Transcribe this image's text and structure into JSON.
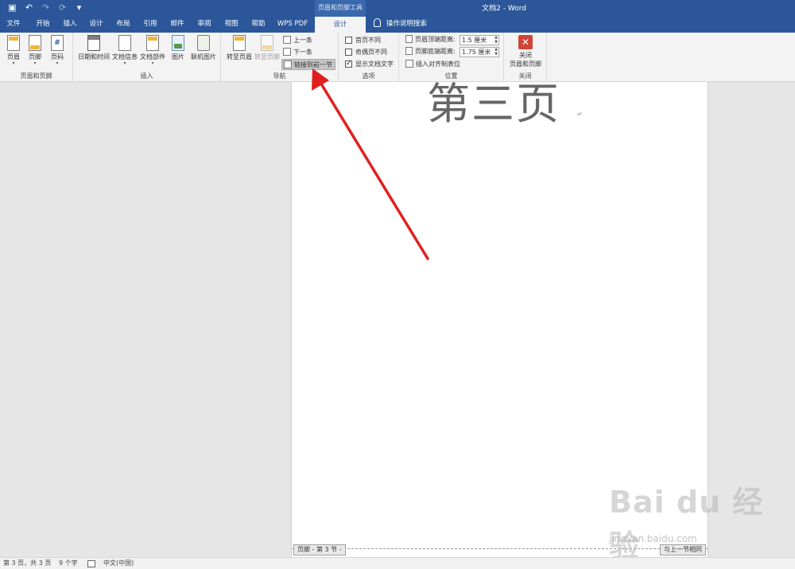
{
  "window": {
    "context_tab_label": "页眉和页脚工具",
    "doc_title": "文档2 - Word"
  },
  "quick_access": [
    "save-icon",
    "undo-icon",
    "redo-icon",
    "repeat-icon",
    "customize-icon"
  ],
  "tabs": [
    {
      "label": "文件"
    },
    {
      "label": "开始"
    },
    {
      "label": "插入"
    },
    {
      "label": "设计"
    },
    {
      "label": "布局"
    },
    {
      "label": "引用"
    },
    {
      "label": "邮件"
    },
    {
      "label": "审阅"
    },
    {
      "label": "视图"
    },
    {
      "label": "帮助"
    },
    {
      "label": "WPS PDF"
    },
    {
      "label": "设计"
    }
  ],
  "tell_me": "操作说明搜索",
  "ribbon": {
    "header_footer": {
      "label": "页眉和页脚",
      "header": "页眉",
      "footer": "页脚",
      "page_number": "页码"
    },
    "insert": {
      "label": "插入",
      "date_time": "日期和时间",
      "doc_info": "文档信息",
      "doc_parts": "文档部件",
      "picture": "图片",
      "online_picture": "联机图片"
    },
    "navigation": {
      "label": "导航",
      "goto_header": "转至页眉",
      "goto_footer": "转至页脚",
      "previous": "上一条",
      "next": "下一条",
      "link_previous": "链接到前一节"
    },
    "options": {
      "label": "选项",
      "different_first": "首页不同",
      "different_odd_even": "奇偶页不同",
      "show_doc_text": "显示文档文字",
      "show_doc_text_checked": true
    },
    "position": {
      "label": "位置",
      "header_top_label": "页眉顶端距离:",
      "header_top_value": "1.5 厘米",
      "footer_bottom_label": "页脚底端距离:",
      "footer_bottom_value": "1.75 厘米",
      "insert_align_tab": "插入对齐制表位"
    },
    "close": {
      "label": "关闭",
      "button_line1": "关闭",
      "button_line2": "页眉和页脚"
    }
  },
  "document": {
    "heading": "第三页",
    "para_mark": "↵",
    "footer_tag": "页脚 - 第 3 节 -",
    "same_as_previous": "与上一节相同"
  },
  "watermark": {
    "logo": "Bai du 经验",
    "url": "jingyan.baidu.com"
  },
  "status": {
    "page": "第 3 页，共 3 页",
    "words": "9 个字",
    "language": "中文(中国)"
  },
  "colors": {
    "title_bar": "#2b579a",
    "annotation_arrow": "#e02020"
  }
}
